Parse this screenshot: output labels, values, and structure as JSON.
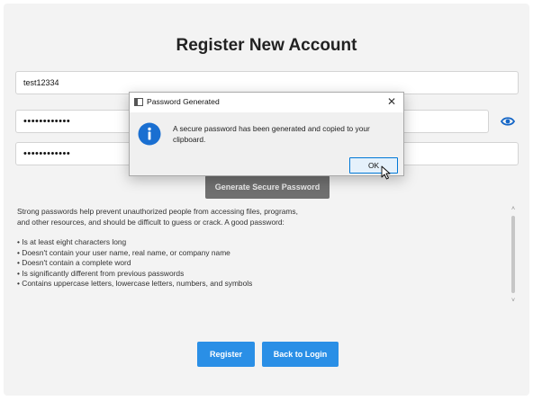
{
  "header": {
    "title": "Register New Account"
  },
  "form": {
    "username_value": "test12334",
    "password_value": "••••••••••••",
    "confirm_value": "••••••••••••"
  },
  "generate_button": {
    "label": "Generate Secure Password"
  },
  "info": {
    "intro": "Strong passwords help prevent unauthorized people from accessing files, programs, and other resources, and should be difficult to guess or crack. A good password:",
    "items": [
      "Is at least eight characters long",
      "Doesn't contain your user name, real name, or company name",
      "Doesn't contain a complete word",
      "Is significantly different from previous passwords",
      "Contains uppercase letters, lowercase letters, numbers, and symbols"
    ]
  },
  "actions": {
    "register_label": "Register",
    "back_label": "Back to Login"
  },
  "dialog": {
    "title": "Password Generated",
    "close_glyph": "✕",
    "message": "A secure password has been generated and copied to your clipboard.",
    "ok_label": "OK"
  },
  "icons": {
    "eye": "eye-icon",
    "info": "info-icon",
    "close": "close-icon"
  },
  "colors": {
    "accent": "#2a8fe6",
    "generate_button": "#707070",
    "info_icon": "#1a6fd1",
    "eye_icon": "#1466c7"
  }
}
